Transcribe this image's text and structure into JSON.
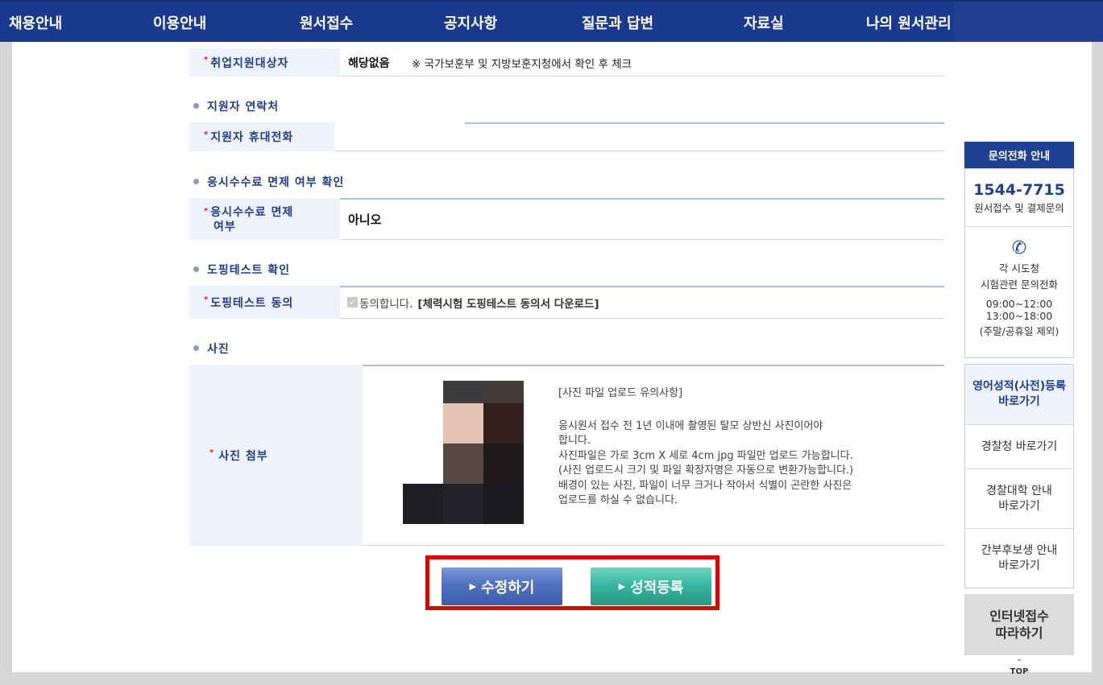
{
  "nav": {
    "items": [
      "채용안내",
      "이용안내",
      "원서접수",
      "공지사항",
      "질문과 답변",
      "자료실",
      "나의 원서관리"
    ]
  },
  "form": {
    "employment_support": {
      "label": "취업지원대상자",
      "value": "해당없음",
      "note": "※ 국가보훈부 및 지방보훈지청에서 확인 후 체크"
    },
    "contact_section": "지원자 연락처",
    "mobile": {
      "label": "지원자 휴대전화",
      "value": ""
    },
    "fee_section": "응시수수료 면제 여부 확인",
    "fee_exempt": {
      "label_line1": "응시수수료 면제",
      "label_line2": "여부",
      "value": "아니오"
    },
    "doping_section": "도핑테스트 확인",
    "doping": {
      "label": "도핑테스트 동의",
      "agree_text": "동의합니다.",
      "download_link": "[체력시험 도핑테스트 동의서 다운로드]",
      "checked": true
    },
    "photo_section": "사진",
    "photo": {
      "label": "사진 첨부",
      "notice_title": "[사진 파일 업로드 유의사항]",
      "notice_lines": [
        "응시원서 접수 전 1년 이내에 촬영된 탈모 상반신 사진이어야",
        "합니다.",
        "사진파일은 가로 3cm X 세로 4cm jpg 파일만 업로드 가능합니다.",
        "(사진 업로드시 크기 및 파일 확장자명은 자동으로 변환가능합니다.)",
        "배경이 있는 사진, 파일이 너무 크거나 작아서 식별이 곤란한 사진은",
        "업로드를 하실 수 없습니다."
      ]
    }
  },
  "buttons": {
    "edit": "수정하기",
    "score": "성적등록"
  },
  "side": {
    "head": "문의전화 안내",
    "phone": "1544-7715",
    "phone_desc": "원서접수 및 결제문의",
    "regional_line1": "각 시도청",
    "regional_line2": "시험관련 문의전화",
    "hours1": "09:00~12:00",
    "hours2": "13:00~18:00",
    "hours_note": "(주말/공휴일 제외)",
    "links": [
      {
        "line1": "영어성적(사전)등록",
        "line2": "바로가기"
      },
      {
        "line1": "경찰청 바로가기",
        "line2": ""
      },
      {
        "line1": "경찰대학 안내",
        "line2": "바로가기"
      },
      {
        "line1": "간부후보생 안내",
        "line2": "바로가기"
      }
    ],
    "guide_line1": "인터넷접수",
    "guide_line2": "따라하기",
    "top": "TOP"
  },
  "colors": {
    "nav": "#1a3a8f",
    "label_text": "#1f3d8a",
    "required": "#e01f1f",
    "highlight": "#e10000"
  }
}
